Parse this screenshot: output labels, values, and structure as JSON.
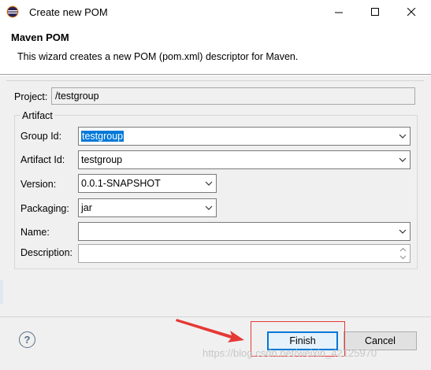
{
  "window": {
    "title": "Create new POM",
    "app_icon": "eclipse-icon"
  },
  "header": {
    "title": "Maven POM",
    "description": "This wizard creates a new POM (pom.xml) descriptor for Maven."
  },
  "project": {
    "label": "Project:",
    "value": "/testgroup"
  },
  "artifact": {
    "legend": "Artifact",
    "group_id": {
      "label": "Group Id:",
      "value": "testgroup"
    },
    "artifact_id": {
      "label": "Artifact Id:",
      "value": "testgroup"
    },
    "version": {
      "label": "Version:",
      "value": "0.0.1-SNAPSHOT"
    },
    "packaging": {
      "label": "Packaging:",
      "value": "jar"
    },
    "name": {
      "label": "Name:",
      "value": ""
    },
    "description": {
      "label": "Description:",
      "value": ""
    }
  },
  "buttons": {
    "finish": "Finish",
    "cancel": "Cancel",
    "help": "?"
  },
  "watermark": "https://blog.csdn.net/weixin_42125970",
  "colors": {
    "accent": "#0078d7",
    "annotation": "#e53935"
  }
}
